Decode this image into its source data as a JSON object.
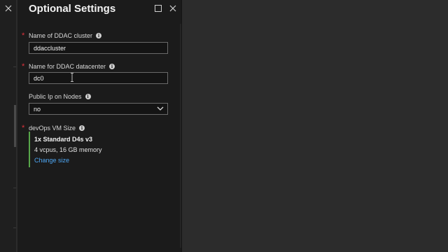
{
  "blade": {
    "title": "Optional Settings"
  },
  "fields": {
    "cluster_name": {
      "label": "Name of DDAC cluster",
      "value": "ddaccluster",
      "required": true
    },
    "datacenter_name": {
      "label": "Name for DDAC datacenter",
      "value": "dc0",
      "required": true
    },
    "public_ip": {
      "label": "Public Ip on Nodes",
      "value": "no"
    },
    "vm_size": {
      "label": "devOps VM Size",
      "required": true,
      "size_name": "1x Standard D4s v3",
      "size_spec": "4 vcpus, 16 GB memory",
      "change_link": "Change size"
    }
  },
  "symbols": {
    "required": "*",
    "info": "i"
  },
  "colors": {
    "accent_link": "#4ea6f2",
    "required_star": "#e0323c",
    "selection_bar": "#57a64a",
    "blade_bg": "#1b1b1b"
  }
}
